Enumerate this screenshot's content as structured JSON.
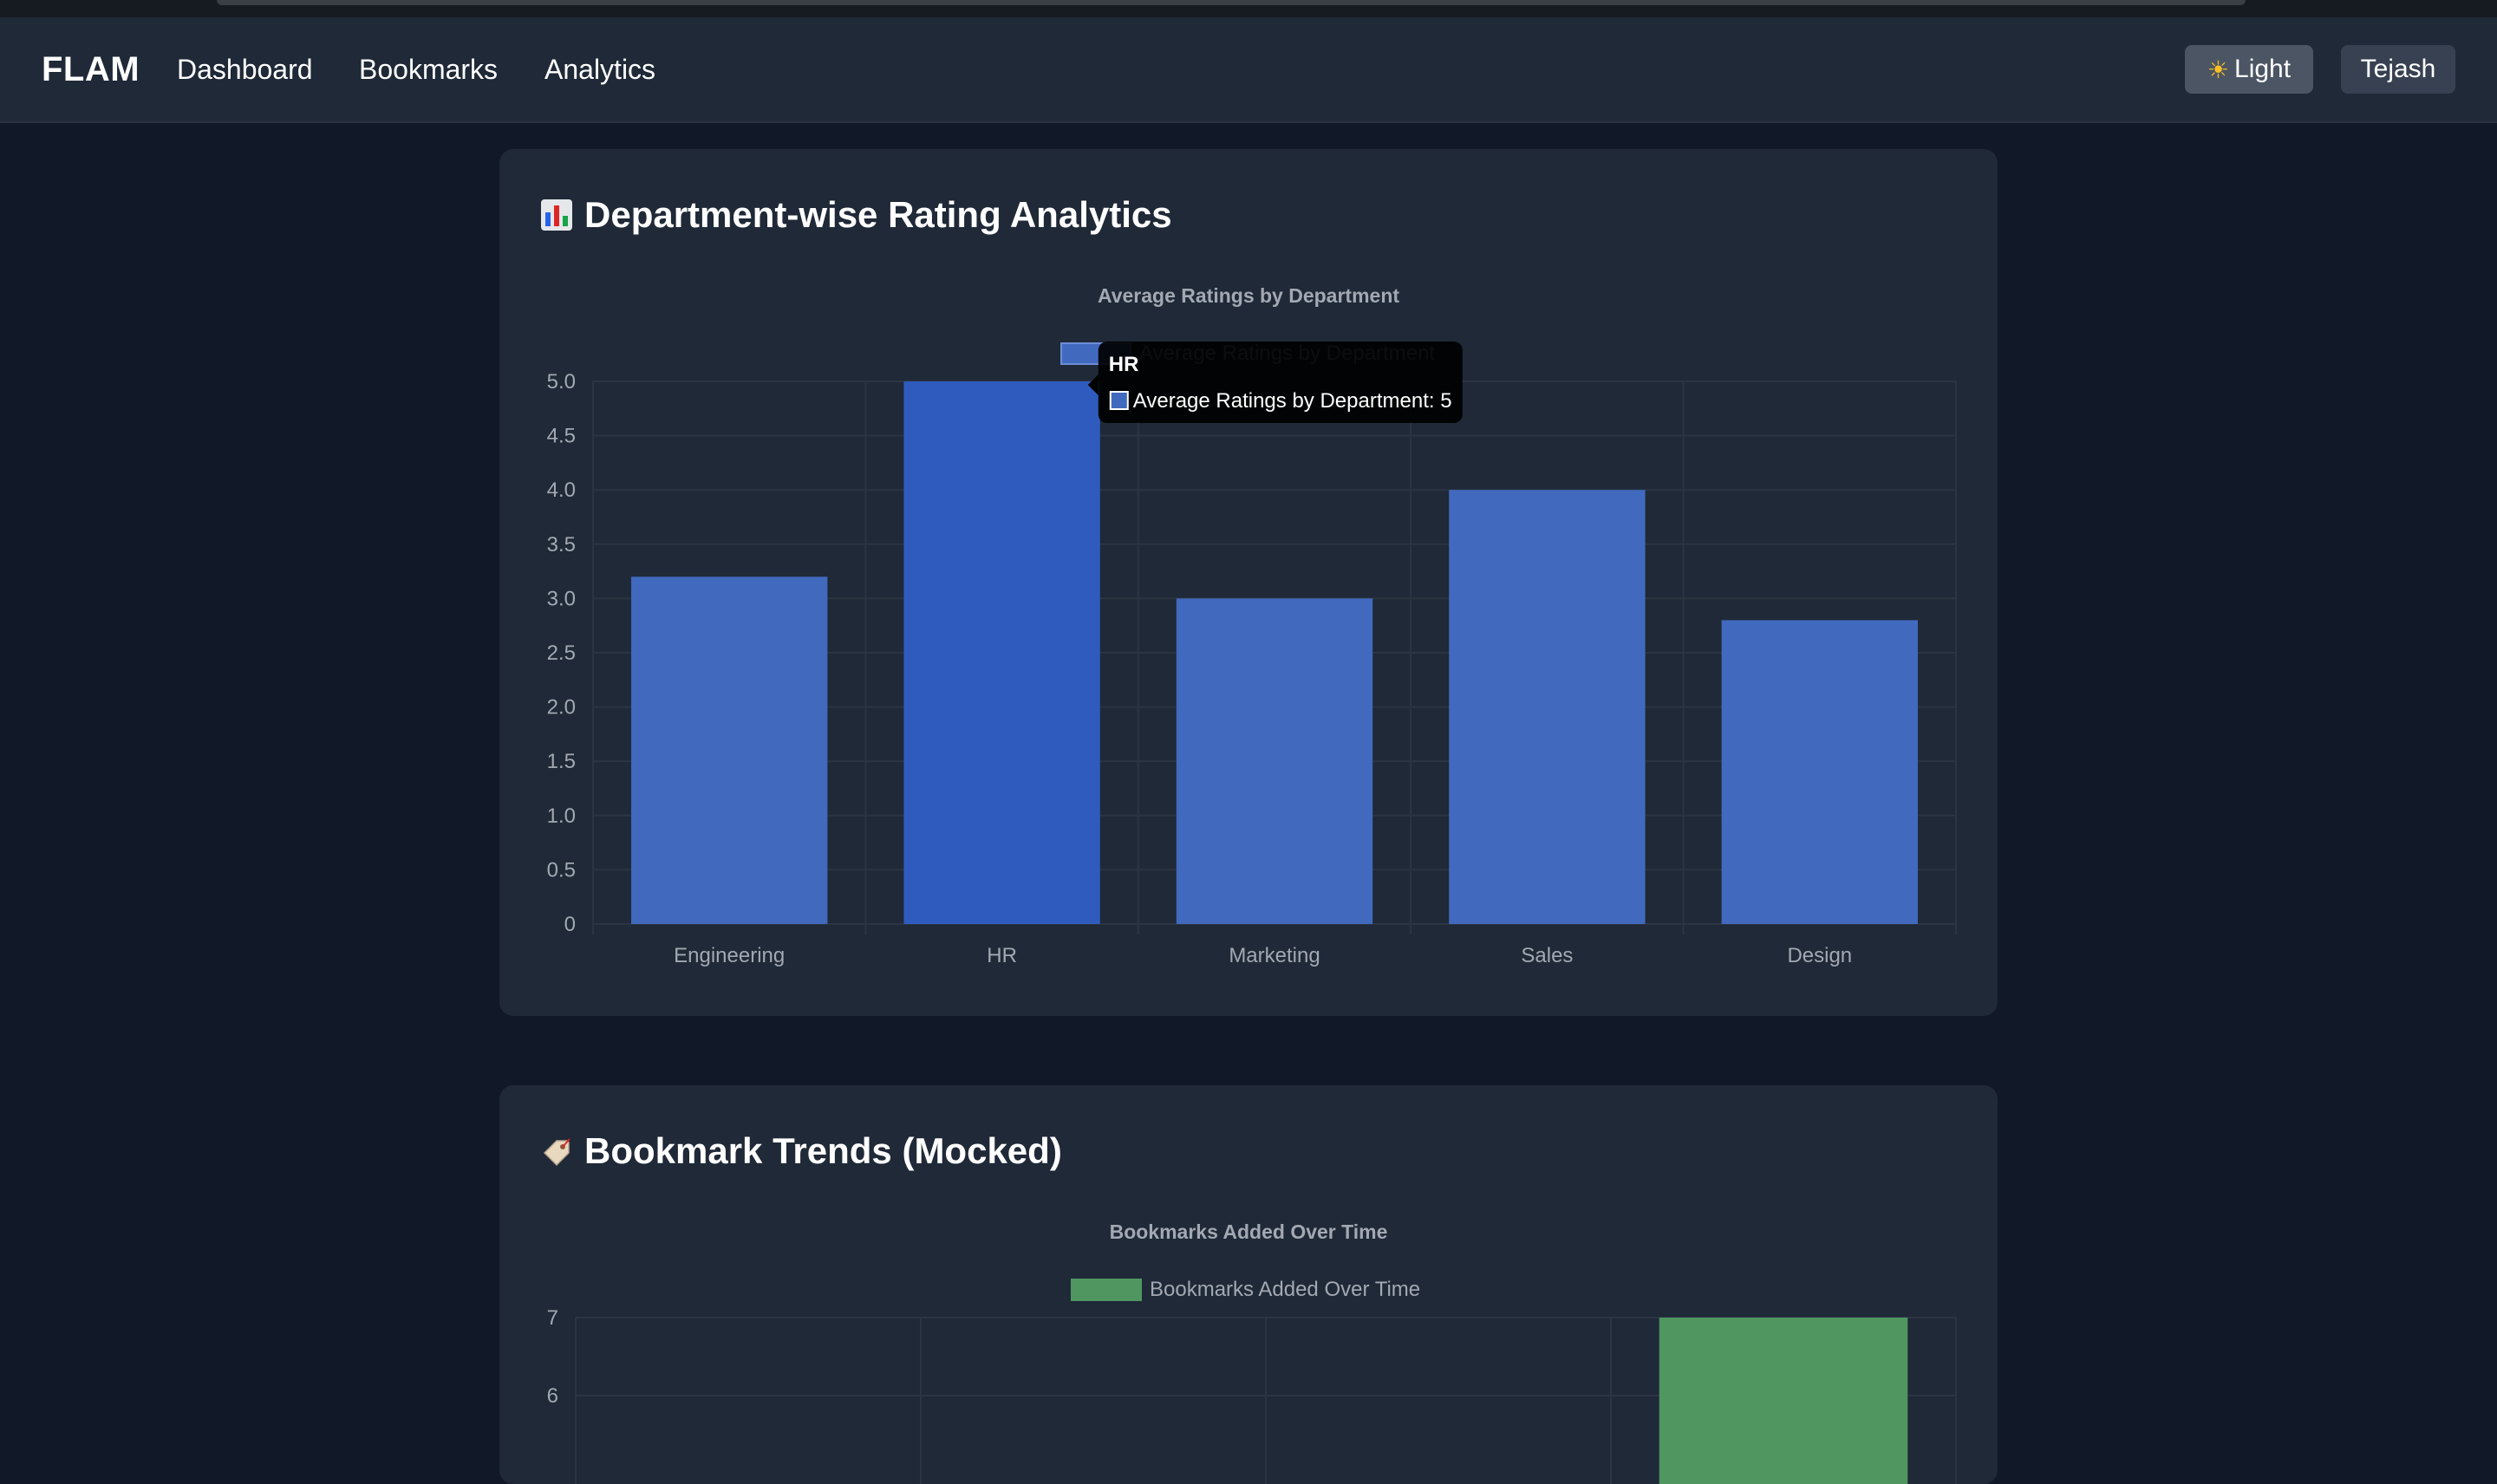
{
  "nav": {
    "brand": "FLAM",
    "links": [
      "Dashboard",
      "Bookmarks",
      "Analytics"
    ],
    "theme_button": "Light",
    "user_button": "Tejash"
  },
  "card1": {
    "title": "Department-wise Rating Analytics",
    "icon": "bar-chart-icon"
  },
  "card2": {
    "title": "Bookmark Trends (Mocked)",
    "icon": "tag-icon"
  },
  "colors": {
    "bar": "#4169be",
    "bar_hover": "#2f5bbf",
    "green_bar": "#4f9660",
    "grid": "#2c3442",
    "tick": "#a3a8b2"
  },
  "chart_data": [
    {
      "type": "bar",
      "title": "Average Ratings by Department",
      "legend": "Average Ratings by Department",
      "categories": [
        "Engineering",
        "HR",
        "Marketing",
        "Sales",
        "Design"
      ],
      "series": [
        {
          "name": "Average Ratings by Department",
          "values": [
            3.2,
            5,
            3.0,
            4.0,
            2.8
          ]
        }
      ],
      "ylim": [
        0,
        5
      ],
      "yticks": [
        "0",
        "0.5",
        "1.0",
        "1.5",
        "2.0",
        "2.5",
        "3.0",
        "3.5",
        "4.0",
        "4.5",
        "5.0"
      ],
      "grid": true,
      "legend_position": "top",
      "tooltip": {
        "title": "HR",
        "label": "Average Ratings by Department: 5"
      }
    },
    {
      "type": "bar",
      "title": "Bookmarks Added Over Time",
      "legend": "Bookmarks Added Over Time",
      "yticks": [
        "7",
        "6"
      ],
      "visible_bar_value": 7,
      "grid": true,
      "legend_position": "top"
    }
  ]
}
